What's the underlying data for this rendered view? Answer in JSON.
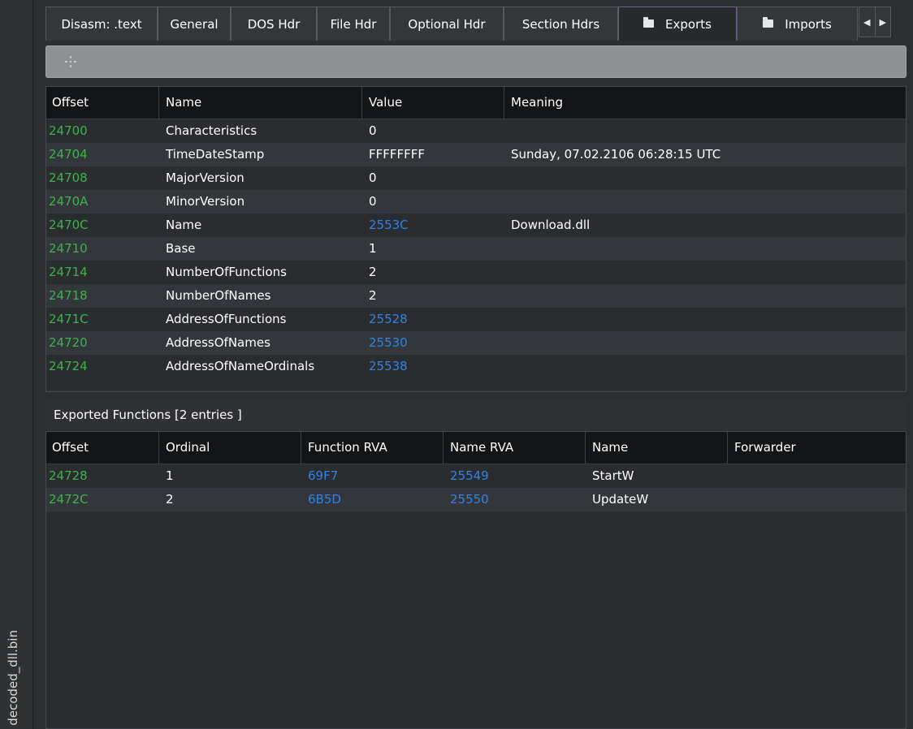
{
  "sidebar": {
    "filename": "decoded_dll.bin"
  },
  "tabs": [
    {
      "label": "Disasm: .text",
      "folder": false,
      "active": false
    },
    {
      "label": "General",
      "folder": false,
      "active": false
    },
    {
      "label": "DOS Hdr",
      "folder": false,
      "active": false
    },
    {
      "label": "File Hdr",
      "folder": false,
      "active": false
    },
    {
      "label": "Optional Hdr",
      "folder": false,
      "active": false
    },
    {
      "label": "Section Hdrs",
      "folder": false,
      "active": false
    },
    {
      "label": "Exports",
      "folder": true,
      "active": true
    },
    {
      "label": "Imports",
      "folder": true,
      "active": false
    }
  ],
  "tab_scroll": {
    "left": "◀",
    "right": "▶"
  },
  "export_dir": {
    "headers": [
      "Offset",
      "Name",
      "Value",
      "Meaning"
    ],
    "rows": [
      {
        "offset": "24700",
        "name": "Characteristics",
        "value": "0",
        "meaning": "",
        "value_link": false
      },
      {
        "offset": "24704",
        "name": "TimeDateStamp",
        "value": "FFFFFFFF",
        "meaning": "Sunday, 07.02.2106 06:28:15 UTC",
        "value_link": false
      },
      {
        "offset": "24708",
        "name": "MajorVersion",
        "value": "0",
        "meaning": "",
        "value_link": false
      },
      {
        "offset": "2470A",
        "name": "MinorVersion",
        "value": "0",
        "meaning": "",
        "value_link": false
      },
      {
        "offset": "2470C",
        "name": "Name",
        "value": "2553C",
        "meaning": "Download.dll",
        "value_link": true
      },
      {
        "offset": "24710",
        "name": "Base",
        "value": "1",
        "meaning": "",
        "value_link": false
      },
      {
        "offset": "24714",
        "name": "NumberOfFunctions",
        "value": "2",
        "meaning": "",
        "value_link": false
      },
      {
        "offset": "24718",
        "name": "NumberOfNames",
        "value": "2",
        "meaning": "",
        "value_link": false
      },
      {
        "offset": "2471C",
        "name": "AddressOfFunctions",
        "value": "25528",
        "meaning": "",
        "value_link": true
      },
      {
        "offset": "24720",
        "name": "AddressOfNames",
        "value": "25530",
        "meaning": "",
        "value_link": true
      },
      {
        "offset": "24724",
        "name": "AddressOfNameOrdinals",
        "value": "25538",
        "meaning": "",
        "value_link": true
      }
    ]
  },
  "exported": {
    "label": "Exported Functions   [2 entries ]",
    "headers": [
      "Offset",
      "Ordinal",
      "Function RVA",
      "Name RVA",
      "Name",
      "Forwarder"
    ],
    "rows": [
      {
        "offset": "24728",
        "ordinal": "1",
        "function_rva": "69F7",
        "name_rva": "25549",
        "name": "StartW",
        "forwarder": ""
      },
      {
        "offset": "2472C",
        "ordinal": "2",
        "function_rva": "6B5D",
        "name_rva": "25550",
        "name": "UpdateW",
        "forwarder": ""
      }
    ]
  },
  "colors": {
    "offset": "#3bb54a",
    "link": "#2f84e8",
    "header_bg": "#141516",
    "active_tab_border": "#6f5f8f"
  }
}
